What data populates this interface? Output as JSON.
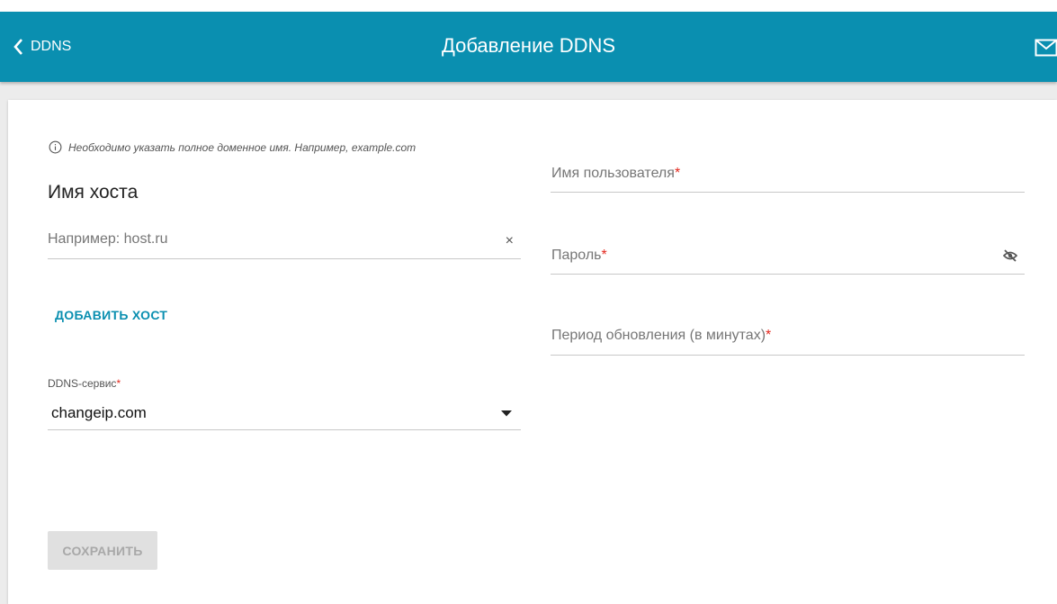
{
  "header": {
    "back_label": "DDNS",
    "title": "Добавление DDNS"
  },
  "form": {
    "hint": "Необходимо указать полное доменное имя. Например, example.com",
    "host_title": "Имя хоста",
    "host_placeholder": "Например: host.ru",
    "clear_symbol": "×",
    "add_host_label": "ДОБАВИТЬ ХОСТ",
    "ddns_service_label": "DDNS-сервис",
    "ddns_service_value": "changeip.com",
    "username_label": "Имя пользователя",
    "password_label": "Пароль",
    "period_label": "Период обновления (в минутах)",
    "required_mark": "*",
    "save_label": "СОХРАНИТЬ"
  },
  "colors": {
    "header_bg": "#0a8fb0",
    "accent": "#0a8fb0",
    "required": "#e3281e"
  },
  "icons": [
    "chevron-left-icon",
    "mail-icon",
    "info-icon",
    "clear-icon",
    "dropdown-arrow-icon",
    "eye-off-icon"
  ]
}
